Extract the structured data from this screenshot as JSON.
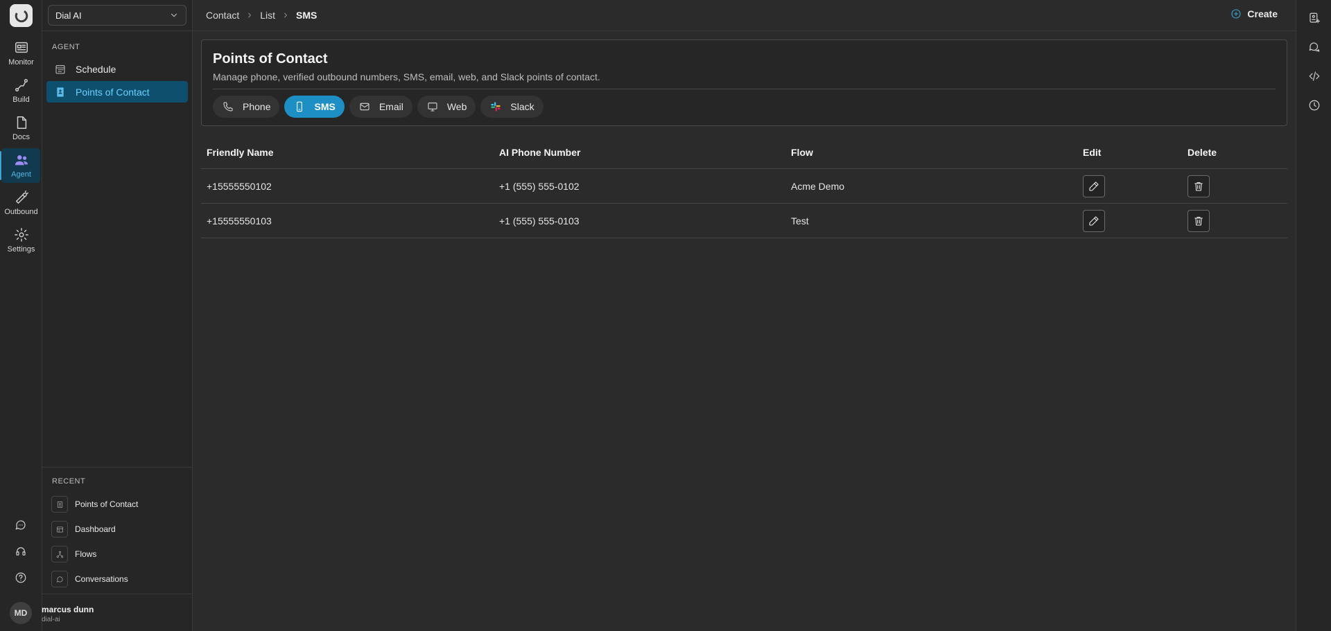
{
  "org_selector": {
    "value": "Dial AI"
  },
  "rail": {
    "items": [
      {
        "label": "Monitor"
      },
      {
        "label": "Build"
      },
      {
        "label": "Docs"
      },
      {
        "label": "Agent"
      },
      {
        "label": "Outbound"
      },
      {
        "label": "Settings"
      }
    ],
    "active": "Agent"
  },
  "sidebar": {
    "section_label": "AGENT",
    "items": [
      {
        "label": "Schedule",
        "icon": "calendar-icon"
      },
      {
        "label": "Points of Contact",
        "icon": "contact-book-icon"
      }
    ],
    "active": "Points of Contact",
    "recent_label": "RECENT",
    "recent": [
      {
        "label": "Points of Contact",
        "icon": "contact-book-icon"
      },
      {
        "label": "Dashboard",
        "icon": "dashboard-icon"
      },
      {
        "label": "Flows",
        "icon": "flows-icon"
      },
      {
        "label": "Conversations",
        "icon": "chat-icon"
      }
    ]
  },
  "user": {
    "initials": "MD",
    "name": "marcus dunn",
    "slug": "dial-ai"
  },
  "breadcrumb": {
    "items": [
      "Contact",
      "List"
    ],
    "current": "SMS"
  },
  "header": {
    "create_label": "Create"
  },
  "card": {
    "title": "Points of Contact",
    "description": "Manage phone, verified outbound numbers, SMS, email, web, and Slack points of contact."
  },
  "tabs": [
    {
      "label": "Phone",
      "icon": "phone-icon"
    },
    {
      "label": "SMS",
      "icon": "mobile-icon"
    },
    {
      "label": "Email",
      "icon": "mail-icon"
    },
    {
      "label": "Web",
      "icon": "monitor-icon"
    },
    {
      "label": "Slack",
      "icon": "slack-icon"
    }
  ],
  "active_tab": "SMS",
  "table": {
    "headers": [
      "Friendly Name",
      "AI Phone Number",
      "Flow",
      "Edit",
      "Delete"
    ],
    "rows": [
      {
        "friendly_name": "+15555550102",
        "ai_phone_number": "+1 (555) 555-0102",
        "flow": "Acme Demo"
      },
      {
        "friendly_name": "+15555550103",
        "ai_phone_number": "+1 (555) 555-0103",
        "flow": "Test"
      }
    ]
  },
  "colors": {
    "accent": "#1d8fc4",
    "active_nav_bg": "#0f4f6e",
    "active_nav_text": "#6ad0ff",
    "background": "#2b2b2b"
  }
}
